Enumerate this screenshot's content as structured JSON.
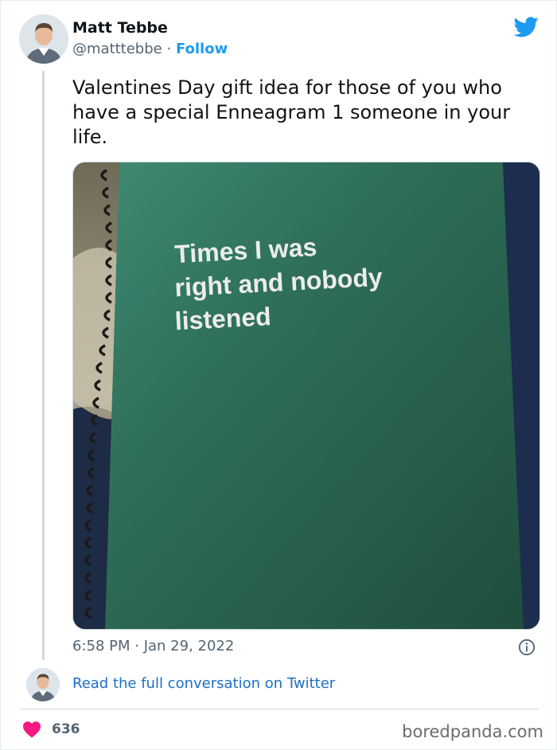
{
  "tweet": {
    "author_name": "Matt Tebbe",
    "handle": "@matttebbe",
    "separator": "·",
    "follow_label": "Follow",
    "text": "Valentines Day gift idea for those of you who have a special Enneagram 1 someone in your life.",
    "timestamp": "6:58 PM · Jan 29, 2022",
    "read_more_label": "Read the full conversation on Twitter",
    "like_count": "636"
  },
  "media": {
    "notebook_lines": [
      "Times I was",
      "right and nobody",
      "listened"
    ]
  },
  "watermark": "boredpanda.com",
  "colors": {
    "brand_blue": "#1d9bf0",
    "link_blue": "#1d6fc4",
    "heart": "#f91880",
    "notebook_green": "#2e6a55"
  },
  "icons": {
    "brand": "twitter-bird-icon",
    "info": "info-icon",
    "like": "heart-icon"
  }
}
